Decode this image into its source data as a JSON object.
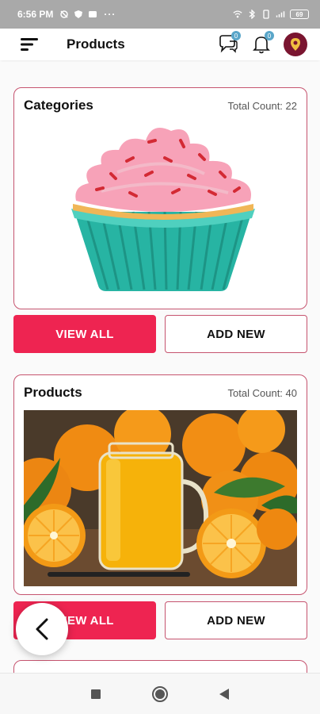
{
  "status_bar": {
    "time": "6:56 PM",
    "dots": "···",
    "battery": "69"
  },
  "app_bar": {
    "title": "Products",
    "chat_badge": "0",
    "notification_badge": "0"
  },
  "cards": [
    {
      "title": "Categories",
      "count_text": "Total Count: 22",
      "image": "cupcake-image",
      "view_all": "VIEW ALL",
      "add_new": "ADD NEW"
    },
    {
      "title": "Products",
      "count_text": "Total Count: 40",
      "image": "orange-juice-image",
      "view_all": "VIEW ALL",
      "add_new": "ADD NEW"
    }
  ],
  "colors": {
    "accent": "#ee2451",
    "border": "#c6546f",
    "badge": "#5aa6c9"
  }
}
